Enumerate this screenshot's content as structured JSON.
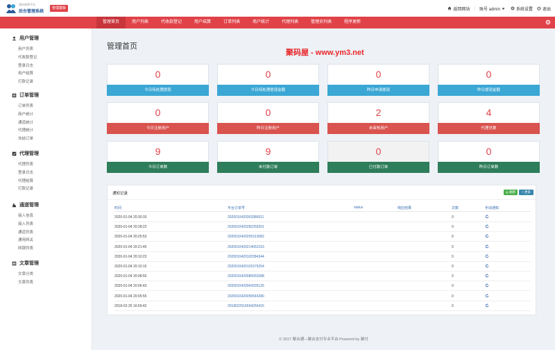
{
  "brand": {
    "small": "银码收款平台",
    "title": "后台管理系统",
    "badge": "管理模板"
  },
  "topnav": {
    "home": "返回网站",
    "account": "账号 admin",
    "settings": "系统设置",
    "logout": "退出"
  },
  "nav": {
    "tabs": [
      "管理首页",
      "用户列表",
      "代收款登记",
      "用户结算",
      "订单列表",
      "商户统计",
      "代理列表",
      "管理员列表",
      "程序更新"
    ],
    "active": 0
  },
  "sidebar": {
    "groups": [
      {
        "title": "用户管理",
        "items": [
          "用户列表",
          "代收款登记",
          "登录日志",
          "用户结算",
          "打款记录"
        ]
      },
      {
        "title": "订单管理",
        "items": [
          "订单列表",
          "商户统计",
          "通道统计",
          "代理统计",
          "冻结订单"
        ]
      },
      {
        "title": "代理管理",
        "items": [
          "代理列表",
          "登录日志",
          "代理结算",
          "打款记录"
        ]
      },
      {
        "title": "通道管理",
        "items": [
          "接入信息",
          "接入列表",
          "通道列表",
          "通用网关",
          "网银列表"
        ]
      },
      {
        "title": "文章管理",
        "items": [
          "文章分类",
          "文章列表"
        ]
      }
    ]
  },
  "page": {
    "title": "管理首页",
    "watermark": "聚码屋 - www.ym3.net"
  },
  "stats": [
    {
      "value": "0",
      "label": "今日待处理提现",
      "color": "blue"
    },
    {
      "value": "0",
      "label": "今日待处理提现金额",
      "color": "blue"
    },
    {
      "value": "0",
      "label": "昨日申请提现",
      "color": "blue"
    },
    {
      "value": "0",
      "label": "昨日提现金额",
      "color": "blue"
    },
    {
      "value": "0",
      "label": "今日注册用户",
      "color": "red"
    },
    {
      "value": "0",
      "label": "昨日注册用户",
      "color": "red"
    },
    {
      "value": "2",
      "label": "未审核用户",
      "color": "red"
    },
    {
      "value": "4",
      "label": "代理总数",
      "color": "red"
    },
    {
      "value": "9",
      "label": "今日订单数",
      "color": "green"
    },
    {
      "value": "9",
      "label": "未付款订单",
      "color": "green"
    },
    {
      "value": "0",
      "label": "已付款订单",
      "color": "green",
      "grey": true
    },
    {
      "value": "0",
      "label": "昨日订单数",
      "color": "green"
    }
  ],
  "notify": {
    "title": "通知记录",
    "refresh_label": "刷新",
    "more_label": "更多",
    "columns": [
      "时间",
      "平台订单号",
      "status",
      "响应结果",
      "次数",
      "手动通知"
    ],
    "rows": [
      {
        "time": "2020-01-04 20:30:33",
        "order": "2020010420303386011",
        "count": "0"
      },
      {
        "time": "2020-01-04 20:28:22",
        "order": "2020010420282256201",
        "count": "0"
      },
      {
        "time": "2020-01-04 20:25:53",
        "order": "2020010420255313082",
        "count": "0"
      },
      {
        "time": "2020-01-04 20:21:40",
        "order": "2020010420214052153",
        "count": "0"
      },
      {
        "time": "2020-01-04 20:10:23",
        "order": "2020010420102384344",
        "count": "0"
      },
      {
        "time": "2020-01-04 20:10:15",
        "order": "2020010420101575254",
        "count": "0"
      },
      {
        "time": "2020-01-04 20:08:55",
        "order": "2020010420085550288",
        "count": "0"
      },
      {
        "time": "2020-01-04 20:06:43",
        "order": "2020010420064335126",
        "count": "0"
      },
      {
        "time": "2020-01-04 20:05:55",
        "order": "2020010420055544280",
        "count": "0"
      },
      {
        "time": "2018-02-25 16:59:42",
        "order": "2018022516594255415",
        "count": "0"
      }
    ]
  },
  "footer": "© 2017 聚合通—聚合支付专业平台 Powered by 聚付",
  "colors": {
    "red": "#e04248",
    "blue": "#3aa7d4",
    "bar_red": "#d9534f",
    "green": "#2e7d5b",
    "link": "#3a6fb0"
  }
}
